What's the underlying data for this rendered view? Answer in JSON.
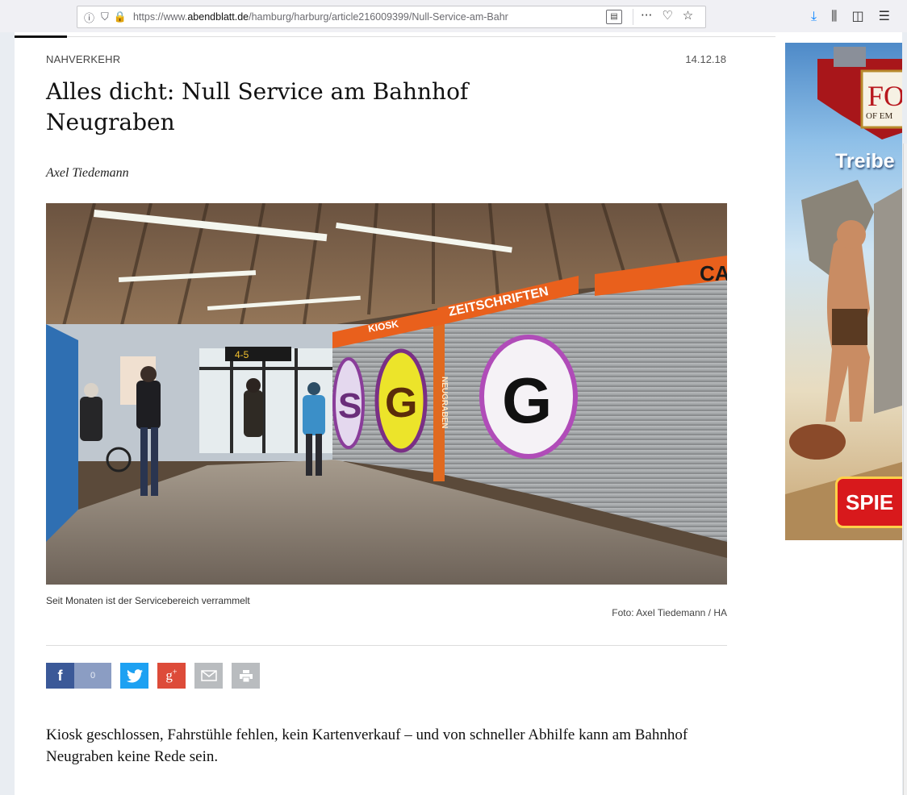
{
  "browser": {
    "url_prefix": "https://www.",
    "url_domain": "abendblatt.de",
    "url_path": "/hamburg/harburg/article216009399/Null-Service-am-Bahr",
    "icons": [
      "info-icon",
      "shield-icon",
      "lock-icon",
      "reader-view-icon",
      "more-icon",
      "pocket-icon",
      "bookmark-star-icon",
      "download-icon",
      "library-icon",
      "sidebar-icon",
      "menu-icon"
    ]
  },
  "article": {
    "kicker": "NAHVERKEHR",
    "date": "14.12.18",
    "headline": "Alles dicht: Null Service am Bahnhof Neugraben",
    "author": "Axel Tiedemann",
    "caption": "Seit Monaten ist der Servicebereich verrammelt",
    "credit": "Foto: Axel Tiedemann / HA",
    "lead": "Kiosk geschlossen, Fahrstühle fehlen, kein Kartenverkauf – und von schneller Abhilfe kann am Bahnhof Neugraben keine Rede sein."
  },
  "photo": {
    "signs": {
      "kiosk": "KIOSK",
      "zeitschriften": "ZEITSCHRIFTEN",
      "vertical": "NEUGRABEN",
      "corner": "CA",
      "platform": "4-5"
    },
    "graffiti": [
      "S",
      "G",
      "G"
    ]
  },
  "share": {
    "facebook_count": "0",
    "facebook_label": "f",
    "googleplus_label": "g",
    "googleplus_sup": "+"
  },
  "ad": {
    "logo_text": "FO",
    "logo_sub": "OF EM",
    "headline": "Treibe",
    "cta": "SPIE"
  }
}
